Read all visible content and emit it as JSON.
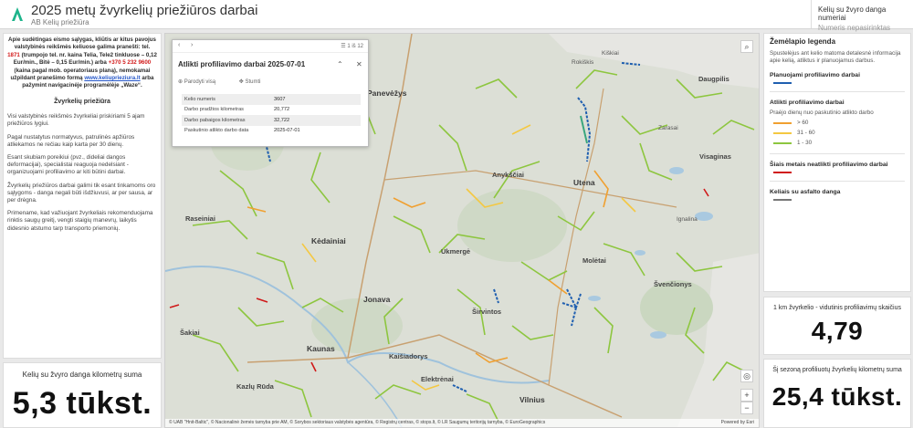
{
  "header": {
    "title": "2025 metų žvyrkelių priežiūros darbai",
    "subtitle": "AB Kelių priežiūra",
    "right_title": "Kelių su žvyro danga numeriai",
    "right_value": "Numeris nepasirinktas"
  },
  "left_panel": {
    "notice_1": "Apie sudėtingas eismo sąlygas, kliūtis ar kitus pavojus valstybinės reikšmės keliuose galima pranešti: tel.",
    "phone_short": "1871",
    "notice_2": "(trumpojo tel. nr. kaina Telia, Tele2 tinkluose – 0,12 Eur/min., Bitė – 0,15 Eur/min.) arba",
    "phone_long": "+370 5 232 9600",
    "notice_3": "(kaina pagal mob. operatoriaus planą), nemokamai užpildant pranešimo formą",
    "link": "www.keliuprieziura.lt",
    "notice_4": "arba pažymint navigacinėje programėlėje „Waze“.",
    "section_title": "Žvyrkelių priežiūra",
    "paragraphs": [
      "Visi valstybinės reikšmės žvyrkeliai priskiriami 5 ajam priežiūros lygiui.",
      "Pagal nustatytus normatyvus, patrulinės apžiūros atliekamos ne rečiau kaip karta per 30 dienų.",
      "Esant skubiam poreikiui (pvz., dideliai dangos deformacijai), specialistai reaguoja nedelsiant - organizuojami profiliavimo ar kiti būtini darbai.",
      "Žvyrkelių priežiūros darbai galimi tik esant tinkamoms oro sąlygoms - danga negali būti išdžiuvusi, ar per sausa, ar per drėgna.",
      "Primename, kad važiuojant žvyrkeliais rekomenduojama rinktis saugų greitį, vengti staigių manevrų, laikytis didesnio atstumo tarp transporto priemonių."
    ]
  },
  "km_indicator": {
    "title": "Kelių su žvyro danga kilometrų suma",
    "value": "5,3 tūkst."
  },
  "popup": {
    "count": "1 iš 12",
    "title": "Atlikti profiliavimo darbai 2025-07-01",
    "zoom_label": "Parodyti visą",
    "move_label": "Stumti",
    "rows": [
      {
        "key": "Kelio numeris",
        "value": "3607"
      },
      {
        "key": "Darbo pradžios kilometras",
        "value": "20,772"
      },
      {
        "key": "Darbo pabaigos kilometras",
        "value": "32,722"
      },
      {
        "key": "Paskutinio atlikto darbo data",
        "value": "2025-07-01"
      }
    ]
  },
  "map": {
    "cities": [
      {
        "name": "Panevėžys",
        "cls": "big"
      },
      {
        "name": "Utena",
        "cls": "big"
      },
      {
        "name": "Kėdainiai",
        "cls": "big"
      },
      {
        "name": "Jonava",
        "cls": "big"
      },
      {
        "name": "Kaunas",
        "cls": "big"
      },
      {
        "name": "Vilnius",
        "cls": "big"
      },
      {
        "name": "Ukmergė",
        "cls": ""
      },
      {
        "name": "Molėtai",
        "cls": ""
      },
      {
        "name": "Anykščiai",
        "cls": ""
      },
      {
        "name": "Širvintos",
        "cls": ""
      },
      {
        "name": "Elektrėnai",
        "cls": ""
      },
      {
        "name": "Kaišiadorys",
        "cls": ""
      },
      {
        "name": "Švenčionys",
        "cls": ""
      },
      {
        "name": "Daugpilis",
        "cls": ""
      },
      {
        "name": "Visaginas",
        "cls": ""
      },
      {
        "name": "Raseiniai",
        "cls": ""
      },
      {
        "name": "Kiškiai",
        "cls": "small"
      },
      {
        "name": "Šakiai",
        "cls": ""
      },
      {
        "name": "Kazlų Rūda",
        "cls": ""
      },
      {
        "name": "Rokiškis",
        "cls": ""
      },
      {
        "name": "Ignalina",
        "cls": ""
      },
      {
        "name": "Zarasai",
        "cls": ""
      }
    ],
    "attribution": "© UAB \"Hnit-Baltic\", © Nacionalinė žemės tarnyba prie AM, © Sorybos sektoriaus valstybės agentūra, © Registrų centras, © stops.lt, © LR Saugumų teritorijų tarnyba, © EuroGeographics",
    "powered": "Powered by Esri"
  },
  "legend": {
    "title": "Žemėlapio legenda",
    "desc": "Spustelėjus ant kelio matoma detalesnė informacija apie kelią, atliktus ir planuojamus darbus.",
    "planned": "Planuojami profiliavimo darbai",
    "done": "Atlikti profiliavimo darbai",
    "days_label": "Praėjo dienų nuo paskutinio atlikto darbo",
    "classes": [
      {
        "label": "> 60",
        "color": "#f0a030"
      },
      {
        "label": "31 - 60",
        "color": "#f4c842"
      },
      {
        "label": "1 - 30",
        "color": "#8dc63f"
      }
    ],
    "not_done": "Šiais metais neatlikti profiliavimo darbai",
    "asphalt": "Keliais su asfalto danga",
    "colors": {
      "planned": "#1f5fb0",
      "not_done": "#d01818",
      "asphalt": "#777777"
    }
  },
  "indicator_avg": {
    "title": "1 km žvyrkelio - vidutinis profiliavimų skaičius",
    "value": "4,79"
  },
  "indicator_season": {
    "title": "Šį sezoną profiliuotų žvyrkelių kilometrų suma",
    "value": "25,4 tūkst."
  }
}
